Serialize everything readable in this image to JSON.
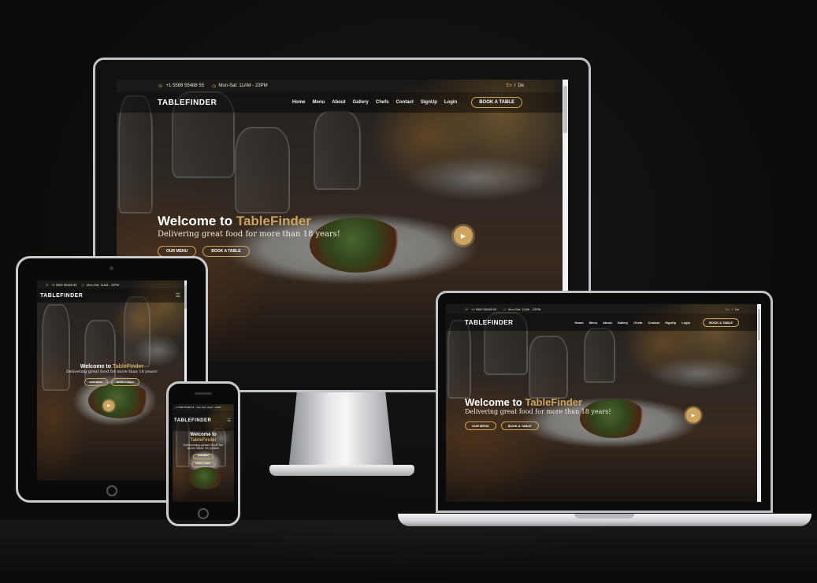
{
  "site": {
    "phone": "+1 5589 55488 55",
    "hours": "Mon-Sat: 11AM - 23PM",
    "lang_en": "En",
    "lang_sep": "/",
    "lang_de": "De",
    "brand": "TABLEFINDER",
    "nav": [
      "Home",
      "Menu",
      "About",
      "Gallery",
      "Chefs",
      "Contact",
      "SignUp",
      "Login"
    ],
    "book_button": "BOOK A TABLE",
    "hero_welcome": "Welcome to",
    "hero_brand": "TableFinder",
    "hero_subtitle": "Delivering great food for more than 18 years!",
    "hero_subtitle_phone_1": "Delivering great food for",
    "hero_subtitle_phone_2": "more than 18 years!",
    "our_menu_button": "OUR MENU",
    "book_table_button": "BOOK A TABLE",
    "accent_color": "#cda45e"
  },
  "icons": {
    "phone": "phone-icon",
    "clock": "clock-icon",
    "play": "play-icon",
    "menu_toggle": "hamburger-icon"
  }
}
